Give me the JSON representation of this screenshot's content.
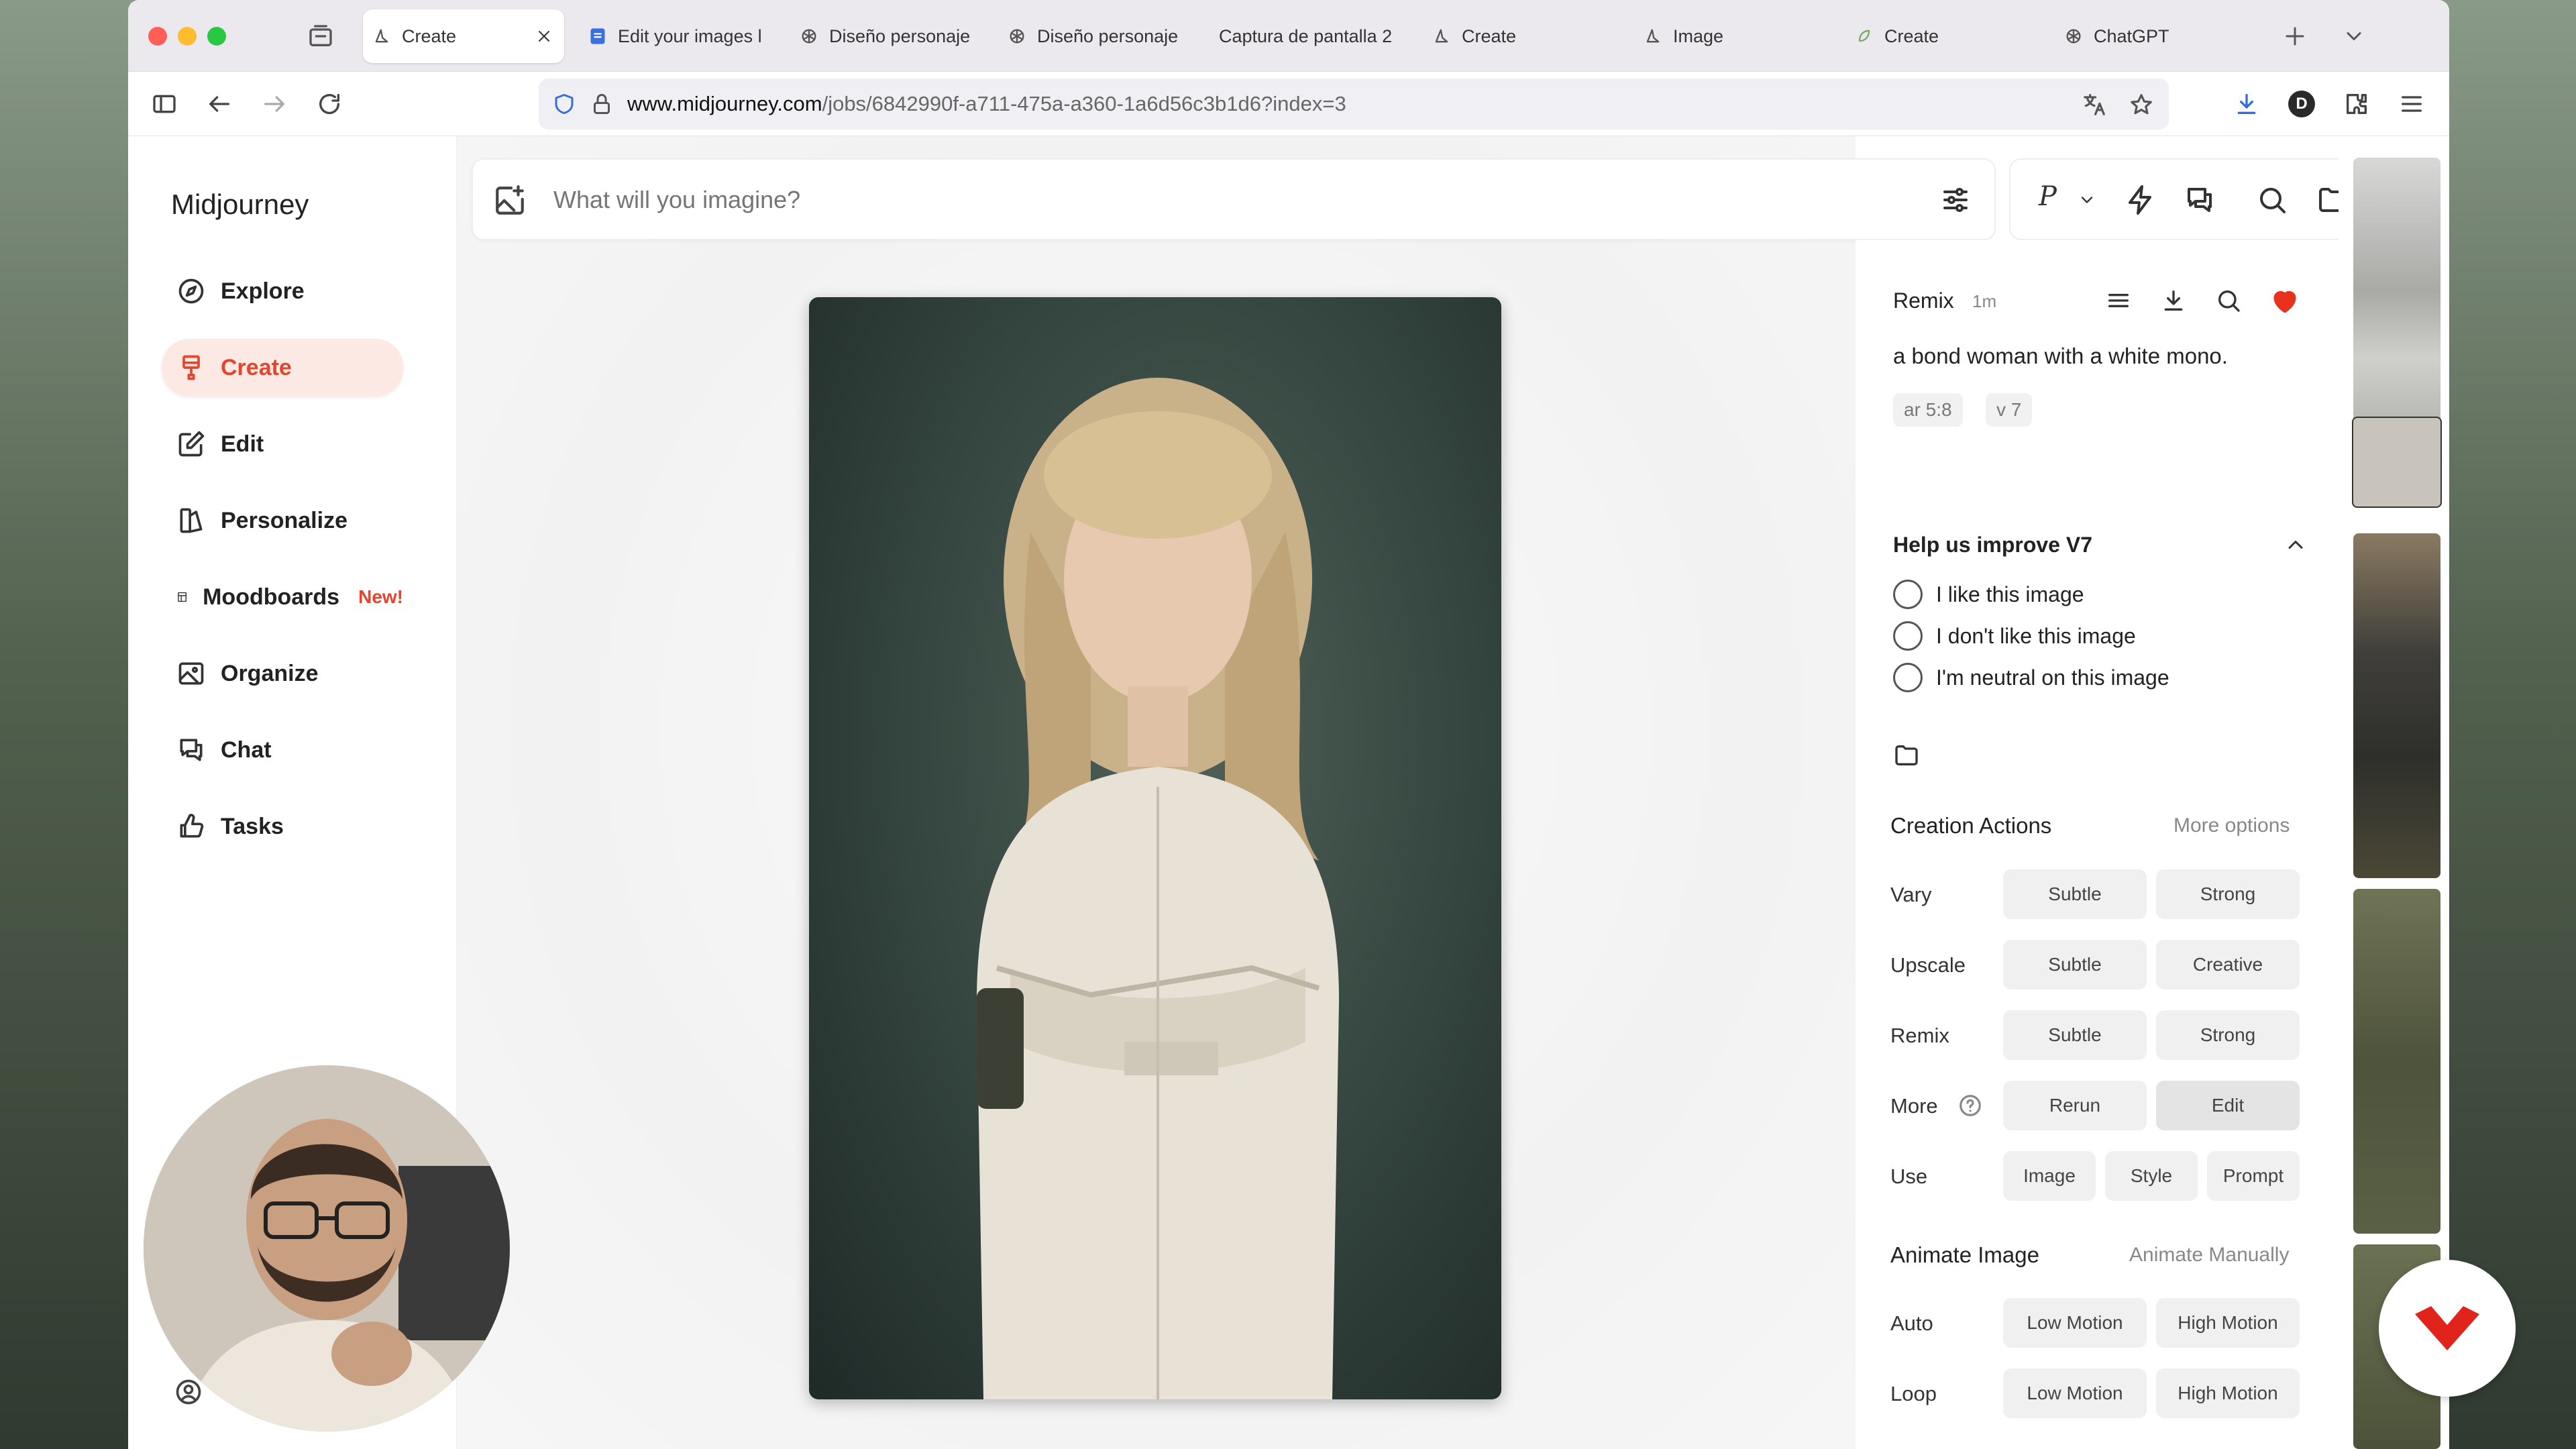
{
  "browser": {
    "tabs": [
      {
        "label": "Create",
        "icon": "midjourney-icon",
        "active": true
      },
      {
        "label": "Edit your images l",
        "icon": "forms-icon"
      },
      {
        "label": "Diseño personaje",
        "icon": "openai-icon"
      },
      {
        "label": "Diseño personaje",
        "icon": "openai-icon"
      },
      {
        "label": "Captura de pantalla 2",
        "icon": ""
      },
      {
        "label": "Create",
        "icon": "midjourney-icon"
      },
      {
        "label": "Image",
        "icon": "midjourney-icon"
      },
      {
        "label": "Create",
        "icon": "leaf-icon"
      },
      {
        "label": "ChatGPT",
        "icon": "openai-icon"
      }
    ],
    "url_domain": "www.midjourney.com",
    "url_path": "/jobs/6842990f-a711-475a-a360-1a6d56c3b1d6?index=3",
    "profile_letter": "D"
  },
  "sidebar": {
    "brand": "Midjourney",
    "items": [
      {
        "label": "Explore",
        "icon": "compass-icon"
      },
      {
        "label": "Create",
        "icon": "brush-icon",
        "active": true
      },
      {
        "label": "Edit",
        "icon": "edit-icon"
      },
      {
        "label": "Personalize",
        "icon": "personalize-icon"
      },
      {
        "label": "Moodboards",
        "icon": "moodboard-icon",
        "badge": "New!"
      },
      {
        "label": "Organize",
        "icon": "image-icon"
      },
      {
        "label": "Chat",
        "icon": "chat-icon"
      },
      {
        "label": "Tasks",
        "icon": "thumbs-up-icon"
      }
    ]
  },
  "prompt": {
    "placeholder": "What will you imagine?"
  },
  "details": {
    "mode": "Remix",
    "age": "1m",
    "prompt_text": "a bond woman with a white mono.",
    "params": [
      "ar 5:8",
      "v 7"
    ],
    "feedback_title": "Help us improve V7",
    "feedback_options": [
      "I like this image",
      "I don't like this image",
      "I'm neutral on this image"
    ],
    "creation_actions_title": "Creation Actions",
    "more_options": "More options",
    "actions": [
      {
        "label": "Vary",
        "buttons": [
          "Subtle",
          "Strong"
        ]
      },
      {
        "label": "Upscale",
        "buttons": [
          "Subtle",
          "Creative"
        ]
      },
      {
        "label": "Remix",
        "buttons": [
          "Subtle",
          "Strong"
        ]
      },
      {
        "label": "More",
        "buttons": [
          "Rerun",
          "Edit"
        ]
      },
      {
        "label": "Use",
        "buttons": [
          "Image",
          "Style",
          "Prompt"
        ]
      }
    ],
    "animate_title": "Animate Image",
    "animate_manually": "Animate Manually",
    "animate_rows": [
      {
        "label": "Auto",
        "buttons": [
          "Low Motion",
          "High Motion"
        ]
      },
      {
        "label": "Loop",
        "buttons": [
          "Low Motion",
          "High Motion"
        ]
      }
    ]
  },
  "colors": {
    "accent": "#e2462d",
    "favorite": "#e8321e"
  }
}
